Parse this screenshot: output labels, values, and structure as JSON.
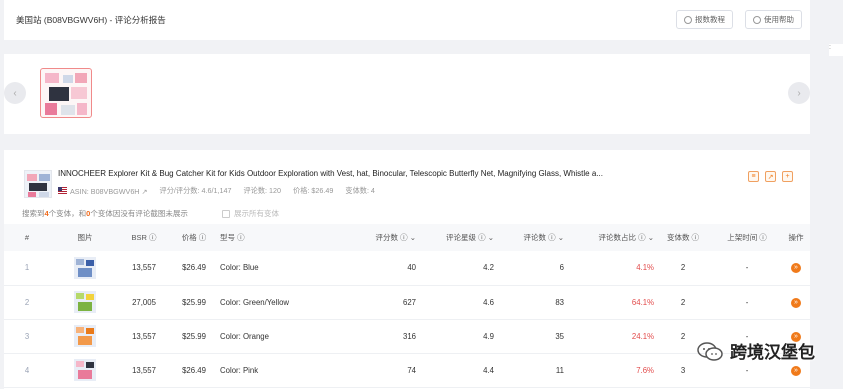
{
  "header": {
    "title": "美国站 (B08VBGWV6H) - 评论分析报告",
    "btn_export": "报数教程",
    "btn_help": "使用帮助"
  },
  "side_marker": ":",
  "carousel": {
    "prev": "‹",
    "next": "›"
  },
  "product": {
    "title": "INNOCHEER Explorer Kit & Bug Catcher Kit for Kids Outdoor Exploration with Vest, hat, Binocular, Telescopic Butterfly Net, Magnifying Glass, Whistle a...",
    "asin": "ASIN: B08VBGWV6H",
    "rating": "评分/评分数: 4.6/1,147",
    "reviews": "评论数: 120",
    "price": "价格: $26.49",
    "variants": "变体数: 4"
  },
  "summary": {
    "prefix": "搜索到",
    "count": "4",
    "mid": "个变体，和",
    "zero": "0",
    "suffix": "个变体因没有评论截图未展示",
    "checkbox_label": "展示所有变体"
  },
  "table": {
    "headers": [
      "#",
      "图片",
      "BSR",
      "价格",
      "型号",
      "评分数",
      "评论星级",
      "评论数",
      "评论数占比",
      "变体数",
      "上架时间",
      "操作"
    ],
    "rows": [
      {
        "idx": "1",
        "bsr": "13,557",
        "price": "$26.49",
        "model": "Color: Blue",
        "ratings": "40",
        "stars": "4.2",
        "reviews": "6",
        "share": "4.1%",
        "variants": "2",
        "listed": "-"
      },
      {
        "idx": "2",
        "bsr": "27,005",
        "price": "$25.99",
        "model": "Color: Green/Yellow",
        "ratings": "627",
        "stars": "4.6",
        "reviews": "83",
        "share": "64.1%",
        "variants": "2",
        "listed": "-"
      },
      {
        "idx": "3",
        "bsr": "13,557",
        "price": "$25.99",
        "model": "Color: Orange",
        "ratings": "316",
        "stars": "4.9",
        "reviews": "35",
        "share": "24.1%",
        "variants": "2",
        "listed": "-"
      },
      {
        "idx": "4",
        "bsr": "13,557",
        "price": "$26.49",
        "model": "Color: Pink",
        "ratings": "74",
        "stars": "4.4",
        "reviews": "11",
        "share": "7.6%",
        "variants": "3",
        "listed": "-"
      }
    ]
  },
  "watermark": {
    "text": "跨境汉堡包"
  },
  "colors": {
    "accent": "#f07a1a",
    "share_red": "#e24b4b",
    "background": "#f1f2f5"
  }
}
